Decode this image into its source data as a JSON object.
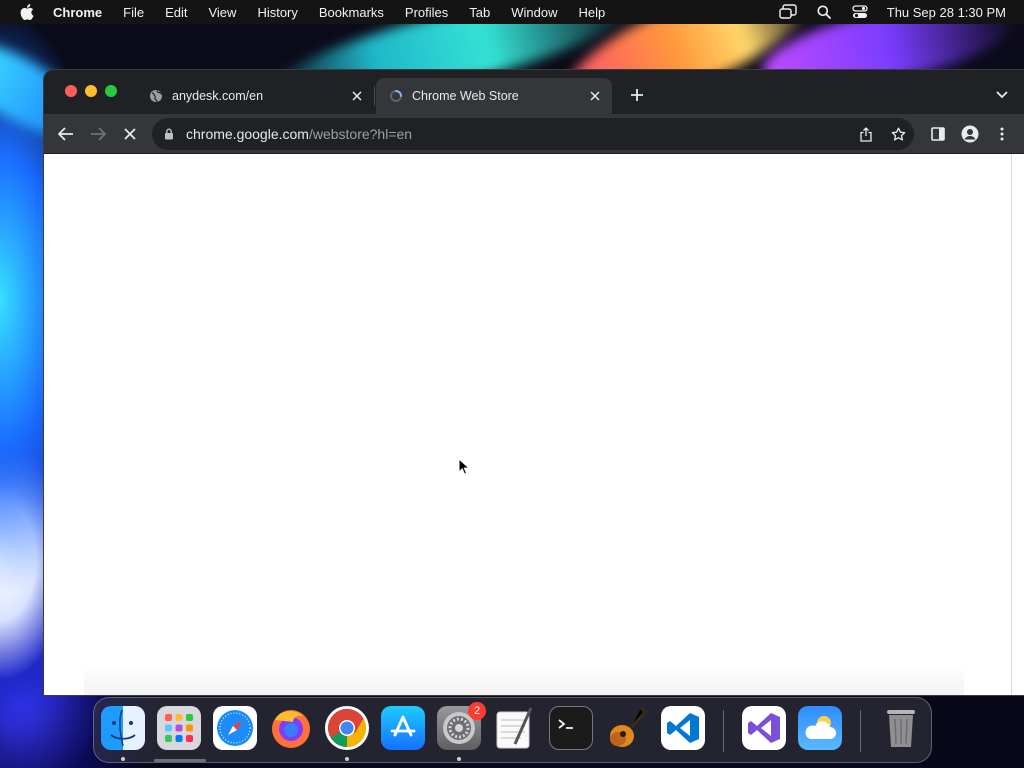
{
  "menubar": {
    "app_name": "Chrome",
    "items": [
      "File",
      "Edit",
      "View",
      "History",
      "Bookmarks",
      "Profiles",
      "Tab",
      "Window",
      "Help"
    ],
    "clock": "Thu Sep 28  1:30 PM"
  },
  "browser": {
    "tabs": [
      {
        "title": "anydesk.com/en",
        "icon": "globe-icon",
        "active": false
      },
      {
        "title": "Chrome Web Store",
        "icon": "web-store-icon",
        "active": true
      }
    ],
    "address": {
      "host": "chrome.google.com",
      "path": "/webstore?hl=en"
    }
  },
  "dock": {
    "apps": [
      {
        "name": "Finder",
        "running": true
      },
      {
        "name": "Launchpad",
        "running": false
      },
      {
        "name": "Safari",
        "running": false
      },
      {
        "name": "Firefox",
        "running": false
      },
      {
        "name": "Google Chrome",
        "running": true
      },
      {
        "name": "App Store",
        "running": false
      },
      {
        "name": "System Settings",
        "running": true,
        "badge": "2"
      },
      {
        "name": "TextEdit",
        "running": false
      },
      {
        "name": "Terminal",
        "running": false
      },
      {
        "name": "GarageBand",
        "running": false
      },
      {
        "name": "Visual Studio Code",
        "running": false
      },
      {
        "name": "Visual Studio",
        "running": false
      },
      {
        "name": "Weather",
        "running": false
      },
      {
        "name": "Trash",
        "running": false
      }
    ]
  },
  "colors": {
    "menubar_bg": "#141414",
    "tabstrip_bg": "#202124",
    "toolbar_bg": "#35363a",
    "omnibox_bg": "#202124",
    "close_red": "#ff5f57",
    "minimize_yellow": "#febc2e",
    "zoom_green": "#28c840",
    "badge_red": "#ff3b30"
  }
}
